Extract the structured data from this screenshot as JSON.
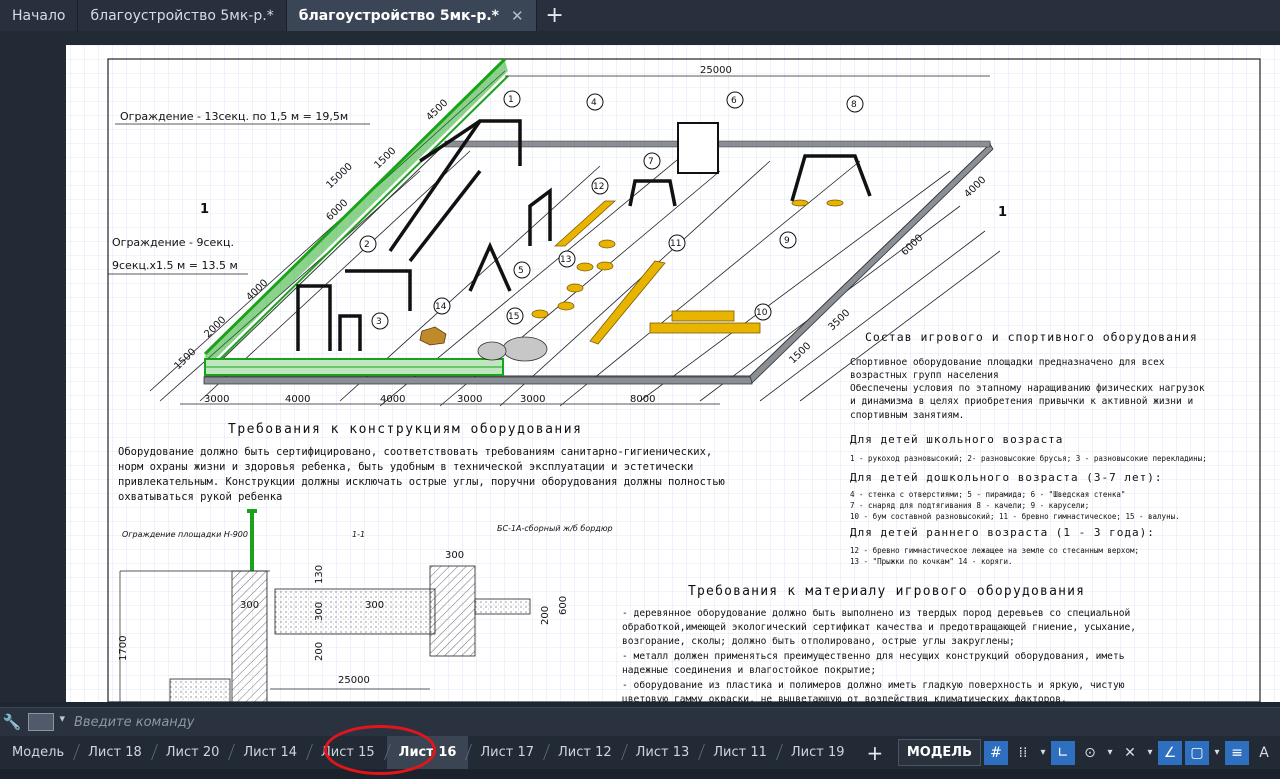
{
  "file_tabs": [
    {
      "label": "Начало"
    },
    {
      "label": "благоустройство 5мк-р.*"
    },
    {
      "label": "благоустройство 5мк-р.*",
      "active": true,
      "close_icon": "close-icon"
    }
  ],
  "drawing": {
    "dim_overall_top": "25000",
    "dim_left_long": "15000",
    "dim_left_seg_a": "4500",
    "dim_left_seg_b": "1500",
    "dim_left_seg_c": "6000",
    "dim_left_seg_d": "4000",
    "dim_left_seg_e": "2000",
    "dim_left_seg_f": "1500",
    "dim_right_a": "4000",
    "dim_right_b": "6000",
    "dim_right_c": "3500",
    "dim_right_d": "1500",
    "dim_bottom": [
      "3000",
      "4000",
      "4000",
      "3000",
      "3000",
      "8000"
    ],
    "fence_label_1": "Ограждение - 13секц. по 1,5 м = 19,5м",
    "fence_label_2": "Ограждение - 9секц.",
    "fence_label_3": "9секц.х1.5 м = 13.5 м",
    "section_mark": "1",
    "callouts": [
      "1",
      "2",
      "3",
      "4",
      "5",
      "6",
      "7",
      "8",
      "9",
      "10",
      "11",
      "12",
      "13",
      "14",
      "15"
    ],
    "req_construct_title": "Требования к конструкциям оборудования",
    "req_construct_text": [
      "Оборудование должно быть сертифицировано, соответствовать требованиям санитарно-гигиенических,",
      "норм охраны жизни и здоровья ребенка, быть удобным в технической эксплуатации и эстетически",
      "привлекательным. Конструкции должны исключать острые углы, поручни оборудования должны полностью",
      "охватываться рукой ребенка"
    ],
    "equip_title": "Состав игрового и спортивного оборудования",
    "equip_intro": [
      "Спортивное оборудование площадки предназначено для всех",
      "возрастных групп населения",
      "Обеспечены условия по этапному наращиванию физических нагрузок",
      "и динамизма в целях приобретения привычки к активной жизни и",
      "спортивным занятиям."
    ],
    "school_title": "Для детей школьного возраста",
    "school_items": [
      "1 - рукоход разновысокий; 2- разновысокие брусья; 3 - разновысокие перекладины;"
    ],
    "preschool_title": "Для детей дошкольного возраста (3-7 лет):",
    "preschool_items": [
      "4 - стенка с отверстиями; 5 - пирамида; 6 - \"Шведская стенка\"",
      "7 - снаряд для подтягивания 8 - качели; 9 - карусели;",
      "10 - бум составной разновысокий; 11 - бревно гимнастическое; 15 - валуны."
    ],
    "early_title": "Для детей раннего возраста (1 - 3 года):",
    "early_items": [
      "12 - бревно гимнастическое лежащее на земле со стесанным верхом;",
      "13 - \"Прыжки по кочкам\" 14 - коряги."
    ],
    "material_title": "Требования к материалу игрового оборудования",
    "material_text": [
      "- деревянное оборудование должно быть выполнено из твердых пород деревьев со специальной",
      "обработкой,имеющей экологический сертификат качества и предотвращающей гниение, усыхание,",
      "возгорание, сколы; должно быть отполировано, острые углы закруглены;",
      "- металл должен применяться преимущественно для несущих конструкций оборудования, иметь",
      "надежные соединения и влагостойкое покрытие;",
      "- оборудование из пластика и полимеров должно иметь гладкую поверхность и яркую, чистую",
      "цветовую гамму окраски, не выцветающую от воздействия климатических факторов."
    ],
    "section_fence_label": "Ограждение площадки Н-900",
    "section_cut_label": "1-1",
    "section_curb_label": "БС-1А-сборный ж/б бордюр",
    "section_dims": {
      "d300a": "300",
      "d300b": "300",
      "d130": "130",
      "d300v": "300",
      "d200": "200",
      "d600": "600",
      "d1700": "1700",
      "d200b": "200",
      "d25000": "25000",
      "d300c": "300"
    }
  },
  "command": {
    "placeholder": "Введите команду"
  },
  "layout_tabs": [
    {
      "label": "Модель"
    },
    {
      "label": "Лист 18"
    },
    {
      "label": "Лист 20"
    },
    {
      "label": "Лист 14"
    },
    {
      "label": "Лист 15"
    },
    {
      "label": "Лист 16",
      "active": true
    },
    {
      "label": "Лист 17"
    },
    {
      "label": "Лист 12"
    },
    {
      "label": "Лист 13"
    },
    {
      "label": "Лист 11"
    },
    {
      "label": "Лист 19"
    }
  ],
  "status": {
    "model_label": "МОДЕЛЬ"
  },
  "colors": {
    "highlight_ring": "#e3151b",
    "fence": "#1aa31a",
    "equipment": "#111111",
    "yellow": "#e8b400"
  }
}
